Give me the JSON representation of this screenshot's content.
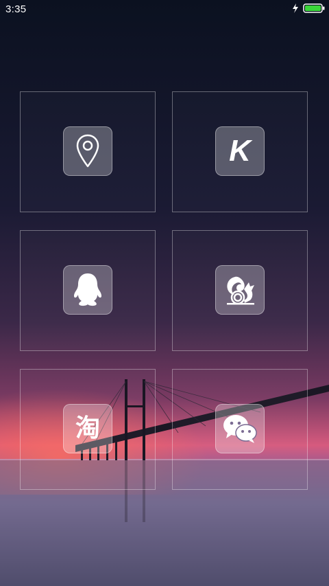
{
  "status_bar": {
    "time": "3:35",
    "charging_icon": "lightning-bolt",
    "battery_icon": "battery-full"
  },
  "grid": {
    "tiles": [
      {
        "name": "maps",
        "icon": "location-pin",
        "glyph": ""
      },
      {
        "name": "kugou",
        "icon": "k-letter",
        "glyph": "K"
      },
      {
        "name": "qq",
        "icon": "penguin",
        "glyph": ""
      },
      {
        "name": "uc-browser",
        "icon": "squirrel",
        "glyph": ""
      },
      {
        "name": "taobao",
        "icon": "tao-character",
        "glyph": "淘"
      },
      {
        "name": "wechat",
        "icon": "chat-bubbles",
        "glyph": ""
      }
    ]
  },
  "colors": {
    "battery_green": "#3ad63a",
    "sky_top": "#0c1222",
    "horizon_pink": "#e84a7a"
  }
}
